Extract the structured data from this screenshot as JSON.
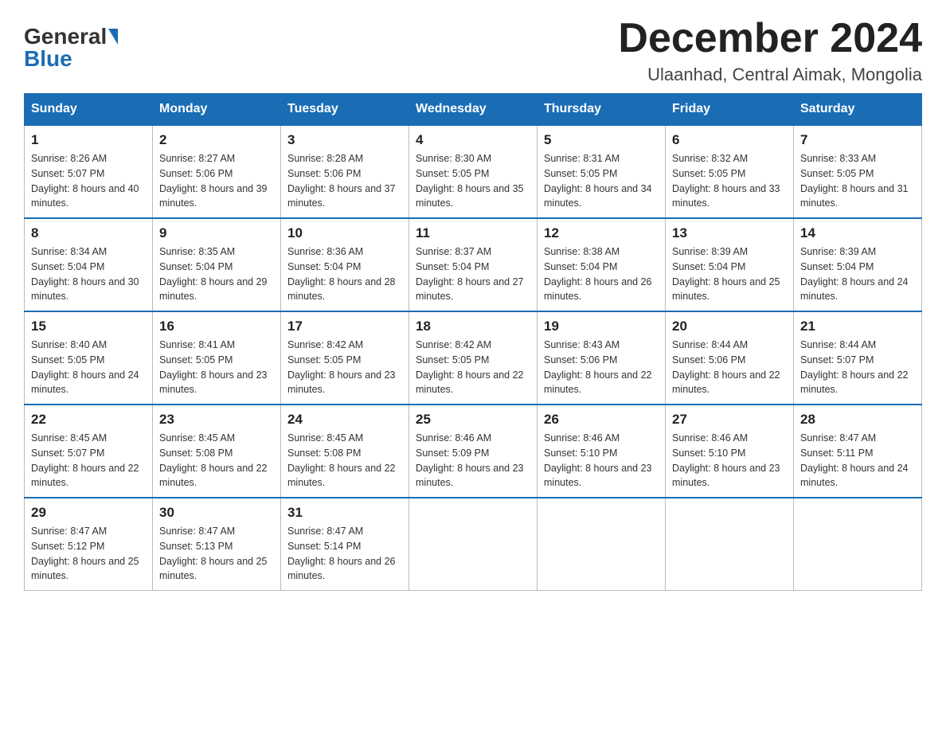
{
  "logo": {
    "general": "General",
    "blue": "Blue"
  },
  "title": "December 2024",
  "subtitle": "Ulaanhad, Central Aimak, Mongolia",
  "headers": [
    "Sunday",
    "Monday",
    "Tuesday",
    "Wednesday",
    "Thursday",
    "Friday",
    "Saturday"
  ],
  "weeks": [
    [
      {
        "day": "1",
        "sunrise": "8:26 AM",
        "sunset": "5:07 PM",
        "daylight": "8 hours and 40 minutes."
      },
      {
        "day": "2",
        "sunrise": "8:27 AM",
        "sunset": "5:06 PM",
        "daylight": "8 hours and 39 minutes."
      },
      {
        "day": "3",
        "sunrise": "8:28 AM",
        "sunset": "5:06 PM",
        "daylight": "8 hours and 37 minutes."
      },
      {
        "day": "4",
        "sunrise": "8:30 AM",
        "sunset": "5:05 PM",
        "daylight": "8 hours and 35 minutes."
      },
      {
        "day": "5",
        "sunrise": "8:31 AM",
        "sunset": "5:05 PM",
        "daylight": "8 hours and 34 minutes."
      },
      {
        "day": "6",
        "sunrise": "8:32 AM",
        "sunset": "5:05 PM",
        "daylight": "8 hours and 33 minutes."
      },
      {
        "day": "7",
        "sunrise": "8:33 AM",
        "sunset": "5:05 PM",
        "daylight": "8 hours and 31 minutes."
      }
    ],
    [
      {
        "day": "8",
        "sunrise": "8:34 AM",
        "sunset": "5:04 PM",
        "daylight": "8 hours and 30 minutes."
      },
      {
        "day": "9",
        "sunrise": "8:35 AM",
        "sunset": "5:04 PM",
        "daylight": "8 hours and 29 minutes."
      },
      {
        "day": "10",
        "sunrise": "8:36 AM",
        "sunset": "5:04 PM",
        "daylight": "8 hours and 28 minutes."
      },
      {
        "day": "11",
        "sunrise": "8:37 AM",
        "sunset": "5:04 PM",
        "daylight": "8 hours and 27 minutes."
      },
      {
        "day": "12",
        "sunrise": "8:38 AM",
        "sunset": "5:04 PM",
        "daylight": "8 hours and 26 minutes."
      },
      {
        "day": "13",
        "sunrise": "8:39 AM",
        "sunset": "5:04 PM",
        "daylight": "8 hours and 25 minutes."
      },
      {
        "day": "14",
        "sunrise": "8:39 AM",
        "sunset": "5:04 PM",
        "daylight": "8 hours and 24 minutes."
      }
    ],
    [
      {
        "day": "15",
        "sunrise": "8:40 AM",
        "sunset": "5:05 PM",
        "daylight": "8 hours and 24 minutes."
      },
      {
        "day": "16",
        "sunrise": "8:41 AM",
        "sunset": "5:05 PM",
        "daylight": "8 hours and 23 minutes."
      },
      {
        "day": "17",
        "sunrise": "8:42 AM",
        "sunset": "5:05 PM",
        "daylight": "8 hours and 23 minutes."
      },
      {
        "day": "18",
        "sunrise": "8:42 AM",
        "sunset": "5:05 PM",
        "daylight": "8 hours and 22 minutes."
      },
      {
        "day": "19",
        "sunrise": "8:43 AM",
        "sunset": "5:06 PM",
        "daylight": "8 hours and 22 minutes."
      },
      {
        "day": "20",
        "sunrise": "8:44 AM",
        "sunset": "5:06 PM",
        "daylight": "8 hours and 22 minutes."
      },
      {
        "day": "21",
        "sunrise": "8:44 AM",
        "sunset": "5:07 PM",
        "daylight": "8 hours and 22 minutes."
      }
    ],
    [
      {
        "day": "22",
        "sunrise": "8:45 AM",
        "sunset": "5:07 PM",
        "daylight": "8 hours and 22 minutes."
      },
      {
        "day": "23",
        "sunrise": "8:45 AM",
        "sunset": "5:08 PM",
        "daylight": "8 hours and 22 minutes."
      },
      {
        "day": "24",
        "sunrise": "8:45 AM",
        "sunset": "5:08 PM",
        "daylight": "8 hours and 22 minutes."
      },
      {
        "day": "25",
        "sunrise": "8:46 AM",
        "sunset": "5:09 PM",
        "daylight": "8 hours and 23 minutes."
      },
      {
        "day": "26",
        "sunrise": "8:46 AM",
        "sunset": "5:10 PM",
        "daylight": "8 hours and 23 minutes."
      },
      {
        "day": "27",
        "sunrise": "8:46 AM",
        "sunset": "5:10 PM",
        "daylight": "8 hours and 23 minutes."
      },
      {
        "day": "28",
        "sunrise": "8:47 AM",
        "sunset": "5:11 PM",
        "daylight": "8 hours and 24 minutes."
      }
    ],
    [
      {
        "day": "29",
        "sunrise": "8:47 AM",
        "sunset": "5:12 PM",
        "daylight": "8 hours and 25 minutes."
      },
      {
        "day": "30",
        "sunrise": "8:47 AM",
        "sunset": "5:13 PM",
        "daylight": "8 hours and 25 minutes."
      },
      {
        "day": "31",
        "sunrise": "8:47 AM",
        "sunset": "5:14 PM",
        "daylight": "8 hours and 26 minutes."
      },
      null,
      null,
      null,
      null
    ]
  ]
}
